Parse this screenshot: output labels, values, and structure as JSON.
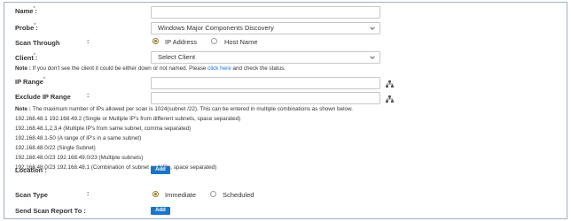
{
  "form": {
    "name_label": "Name",
    "name_req": "*",
    "probe_label": "Probe",
    "probe_req": "*",
    "probe_value": "Windows Major Components Discovery",
    "scan_through_label": "Scan Through",
    "scan_through_options": [
      "IP Address",
      "Host Name"
    ],
    "client_label": "Client",
    "client_req": "*",
    "client_value": "Select Client",
    "client_note_prefix": "Note :",
    "client_note_text": " If you don't see the client it could be either down or not named. Please ",
    "client_note_link": "click here",
    "client_note_suffix": " and check the status.",
    "ip_range_label": "IP Range",
    "ip_range_req": "*",
    "exclude_ip_label": "Exclude IP Range",
    "colon": ":",
    "ip_note_prefix": "Note :",
    "ip_note_text": " The maximum number of IPs allowed per scan is 1024(subnet /22). This can be entered in multiple combinations as shown below.",
    "examples": [
      "192.168.48.1 192.168.49.2 (Single or Multiple IP's from different subnets, space separated)",
      "192.168.48.1,2,3,4 (Multiple IP's from same subnet, comma separated)",
      "192.168.48.1-50 (A range of IP's in a same subnet)",
      "192.168.48.0/22 (Single Subnet)",
      "192.168.48.0/23 192.168.49.0/23 (Multiple subnets)",
      "192.168.48.0/23 192.168.48.1 (Combination of subnet and IP's, space separated)"
    ],
    "location_label": "Location :",
    "location_button": "Add",
    "scan_type_label": "Scan Type",
    "scan_type_options": [
      "Immediate",
      "Scheduled"
    ],
    "send_report_label": "Send Scan Report To :",
    "send_report_button": "Add"
  },
  "colors": {
    "button_bg": "#1875c8",
    "link": "#1b6fcf",
    "radio_selected": "#9a7b2f",
    "frame_border": "#9fb1c4"
  },
  "icons": {
    "dropdown": "chevron-down-icon",
    "tree": "network-tree-icon"
  }
}
